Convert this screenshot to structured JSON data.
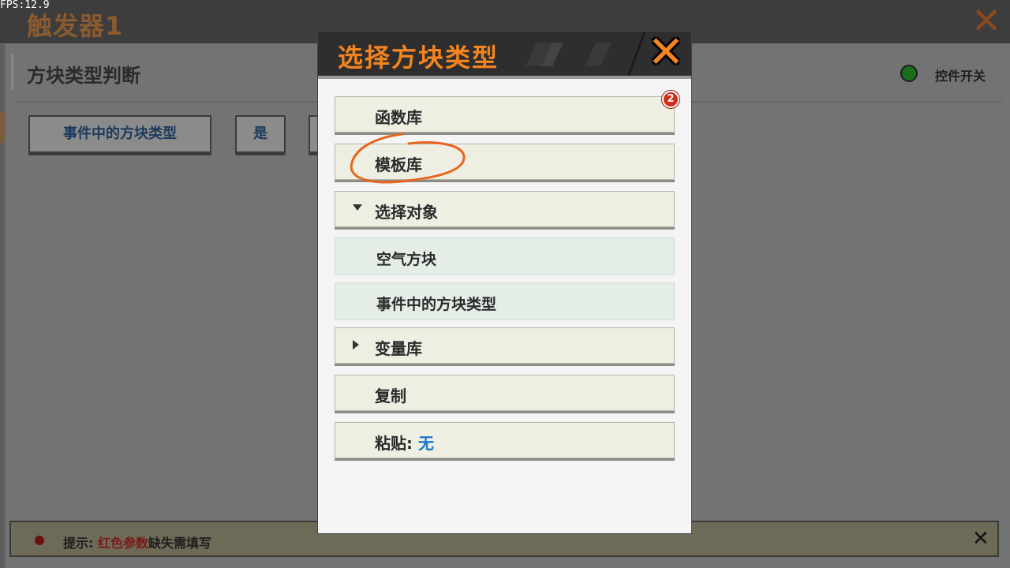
{
  "fps": "FPS:12.9",
  "editor": {
    "title": "触发器1",
    "section_title": "方块类型判断",
    "buttons": [
      "事件中的方块类型",
      "是"
    ],
    "switch_label": "控件开关",
    "hint": {
      "prefix": "提示: ",
      "highlight": "红色参数",
      "suffix": "缺失需填写"
    }
  },
  "modal": {
    "title": "选择方块类型",
    "badge_count": "2",
    "items": {
      "functions": "函数库",
      "templates": "模板库",
      "select_object": "选择对象",
      "air_block": "空气方块",
      "event_block_type": "事件中的方块类型",
      "variables": "变量库",
      "copy": "复制",
      "paste_label": "粘贴: ",
      "paste_value": "无"
    }
  },
  "colors": {
    "accent_orange": "#f3841f",
    "paste_value_blue": "#1878c8",
    "annotation": "#e8651e",
    "switch_on": "#1a6e1a"
  }
}
